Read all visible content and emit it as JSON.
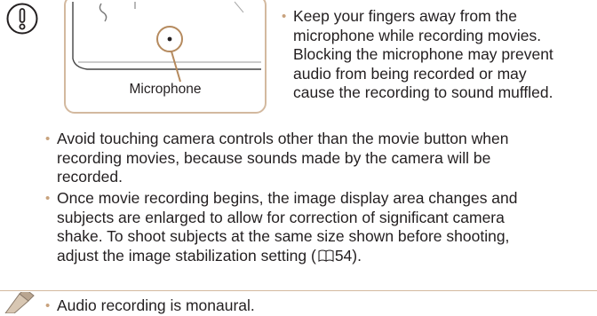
{
  "figure": {
    "caption": "Microphone"
  },
  "caution_bullet": {
    "lines": [
      "Keep your fingers away from the",
      "microphone while recording movies.",
      "Blocking the microphone may prevent",
      "audio from being recorded or may",
      "cause the recording to sound muffled."
    ]
  },
  "bullets": [
    {
      "lines": [
        "Avoid touching camera controls other than the movie button when",
        "recording movies, because sounds made by the camera will be",
        "recorded."
      ]
    },
    {
      "lines": [
        "Once movie recording begins, the image display area changes and",
        "subjects are enlarged to allow for correction of significant camera",
        "shake. To shoot subjects at the same size shown before shooting,"
      ],
      "last_line_prefix": "adjust the image stabilization setting (",
      "page_ref": "54",
      "last_line_suffix": ")."
    }
  ],
  "note": {
    "text": "Audio recording is monaural."
  },
  "colors": {
    "accent": "#c8a27d",
    "text": "#231f20",
    "frame": "#d3b99f"
  }
}
